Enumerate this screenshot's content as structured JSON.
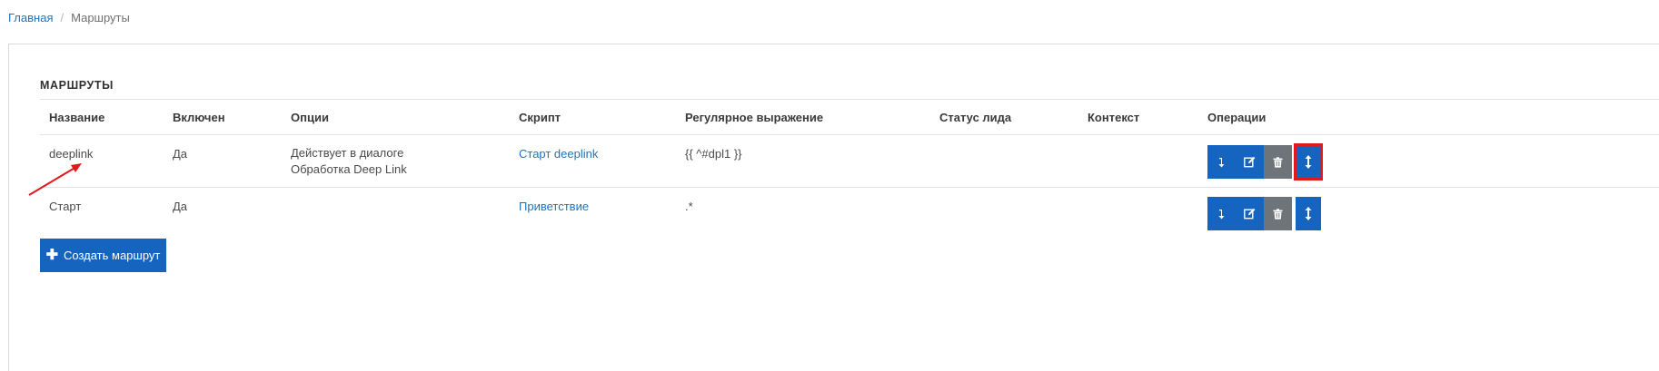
{
  "breadcrumb": {
    "home": "Главная",
    "separator": "/",
    "current": "Маршруты"
  },
  "panel": {
    "title": "МАРШРУТЫ"
  },
  "table": {
    "headers": [
      "Название",
      "Включен",
      "Опции",
      "Скрипт",
      "Регулярное выражение",
      "Статус лида",
      "Контекст",
      "Операции"
    ],
    "rows": [
      {
        "name": "deeplink",
        "enabled": "Да",
        "options": [
          "Действует в диалоге",
          "Обработка Deep Link"
        ],
        "script": "Старт deeplink",
        "regex": "{{ ^#dpl1 }}",
        "lead_status": "",
        "context": ""
      },
      {
        "name": "Старт",
        "enabled": "Да",
        "options": [],
        "script": "Приветствие",
        "regex": ".*",
        "lead_status": "",
        "context": ""
      }
    ]
  },
  "operations": {
    "icons": [
      "move-to-icon",
      "edit-icon",
      "trash-icon",
      "sort-icon"
    ]
  },
  "create_button": {
    "label": "Создать маршрут"
  },
  "colors": {
    "primary": "#1565c0",
    "secondary": "#6d757a",
    "link": "#1e73be",
    "highlight": "#e0191a",
    "annotation_arrow": "#e0191a"
  }
}
